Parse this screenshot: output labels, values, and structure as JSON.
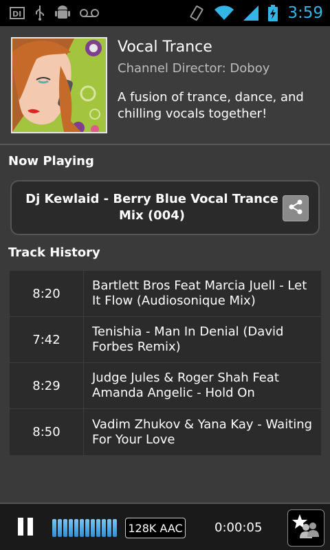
{
  "status_bar": {
    "time": "3:59",
    "icons": [
      "di-icon",
      "usb-icon",
      "android-debug-icon",
      "voicemail-icon",
      "vibrate-icon",
      "wifi-icon",
      "signal-icon",
      "battery-charging-icon"
    ],
    "accent": "#33b5e5"
  },
  "channel": {
    "title": "Vocal Trance",
    "director": "Channel Director: Doboy",
    "description": "A fusion of trance, dance, and chilling vocals together!"
  },
  "now_playing": {
    "heading": "Now Playing",
    "track": "Dj Kewlaid - Berry Blue Vocal Trance Mix (004)"
  },
  "history": {
    "heading": "Track History",
    "rows": [
      {
        "duration": "8:20",
        "title": "Bartlett Bros Feat Marcia Juell - Let It Flow (Audiosonique Mix)"
      },
      {
        "duration": "7:42",
        "title": "Tenishia - Man In Denial (David Forbes Remix)"
      },
      {
        "duration": "8:29",
        "title": "Judge Jules & Roger Shah Feat Amanda Angelic - Hold On"
      },
      {
        "duration": "8:50",
        "title": "Vadim Zhukov & Yana Kay - Waiting For Your Love"
      }
    ]
  },
  "player": {
    "bitrate": "128K AAC",
    "elapsed": "0:00:05",
    "buffer_fill": 1.0
  }
}
